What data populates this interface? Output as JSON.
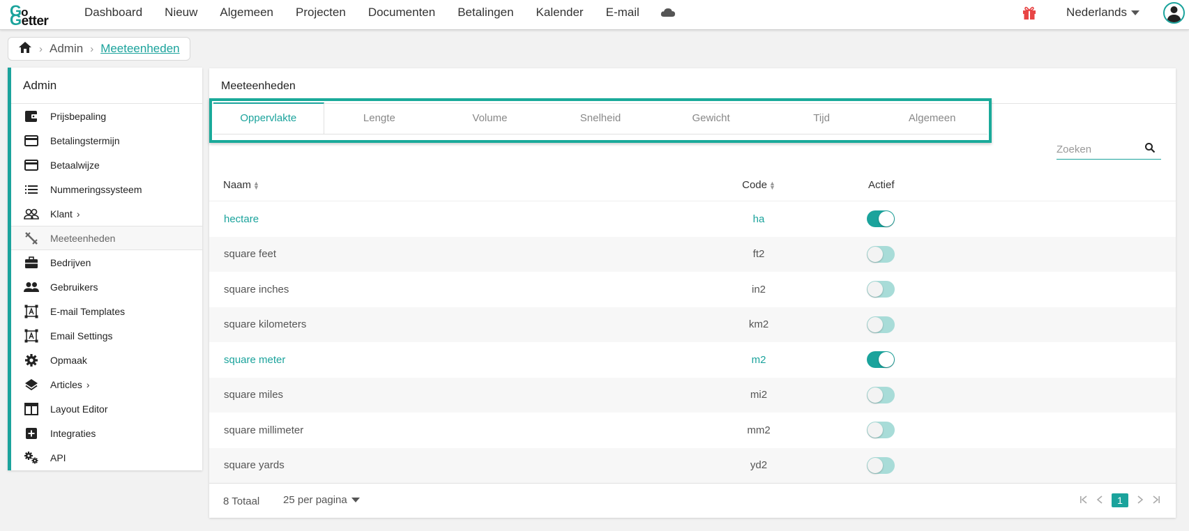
{
  "brand": {
    "line1": "Go",
    "line2": "getter",
    "accent": "#1ba39c"
  },
  "nav": {
    "items": [
      "Dashboard",
      "Nieuw",
      "Algemeen",
      "Projecten",
      "Documenten",
      "Betalingen",
      "Kalender",
      "E-mail"
    ],
    "language": "Nederlands"
  },
  "breadcrumb": {
    "parent": "Admin",
    "current": "Meeteenheden"
  },
  "sidebar": {
    "title": "Admin",
    "items": [
      {
        "label": "Prijsbepaling",
        "icon": "wallet-icon"
      },
      {
        "label": "Betalingstermijn",
        "icon": "credit-card-icon"
      },
      {
        "label": "Betaalwijze",
        "icon": "credit-card-icon"
      },
      {
        "label": "Nummeringssysteem",
        "icon": "list-icon"
      },
      {
        "label": "Klant",
        "icon": "people-outline-icon",
        "expandable": true
      },
      {
        "label": "Meeteenheden",
        "icon": "ruler-icon",
        "active": true
      },
      {
        "label": "Bedrijven",
        "icon": "briefcase-icon"
      },
      {
        "label": "Gebruikers",
        "icon": "people-icon"
      },
      {
        "label": "E-mail Templates",
        "icon": "text-frame-icon"
      },
      {
        "label": "Email Settings",
        "icon": "text-frame-icon"
      },
      {
        "label": "Opmaak",
        "icon": "gear-icon"
      },
      {
        "label": "Articles",
        "icon": "layers-icon",
        "expandable": true
      },
      {
        "label": "Layout Editor",
        "icon": "layout-icon"
      },
      {
        "label": "Integraties",
        "icon": "plus-box-icon"
      },
      {
        "label": "API",
        "icon": "gears-icon"
      }
    ]
  },
  "panel": {
    "title": "Meeteenheden",
    "tabs": [
      "Oppervlakte",
      "Lengte",
      "Volume",
      "Snelheid",
      "Gewicht",
      "Tijd",
      "Algemeen"
    ],
    "active_tab": "Oppervlakte",
    "search_placeholder": "Zoeken"
  },
  "table": {
    "headers": {
      "name": "Naam",
      "code": "Code",
      "active": "Actief"
    },
    "rows": [
      {
        "name": "hectare",
        "code": "ha",
        "active": true
      },
      {
        "name": "square feet",
        "code": "ft2",
        "active": false
      },
      {
        "name": "square inches",
        "code": "in2",
        "active": false
      },
      {
        "name": "square kilometers",
        "code": "km2",
        "active": false
      },
      {
        "name": "square meter",
        "code": "m2",
        "active": true
      },
      {
        "name": "square miles",
        "code": "mi2",
        "active": false
      },
      {
        "name": "square millimeter",
        "code": "mm2",
        "active": false
      },
      {
        "name": "square yards",
        "code": "yd2",
        "active": false
      }
    ]
  },
  "footer": {
    "total": "8 Totaal",
    "per_page": "25 per pagina",
    "current_page": "1"
  }
}
